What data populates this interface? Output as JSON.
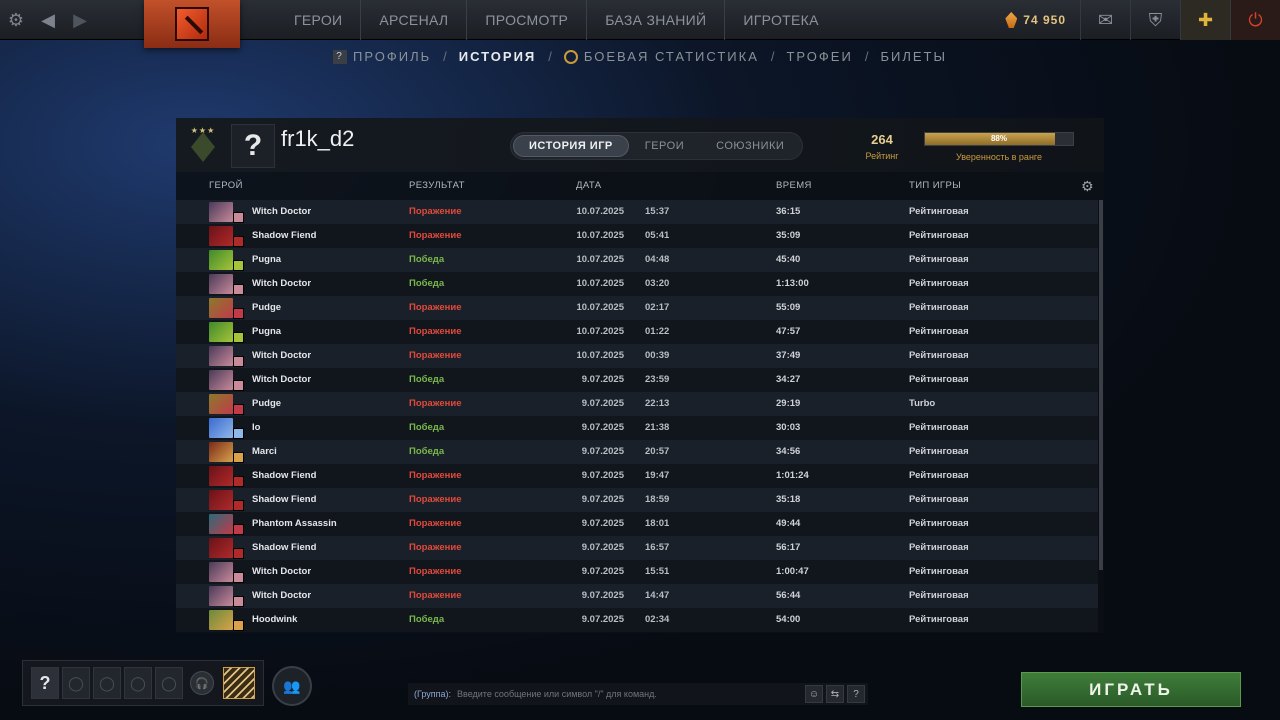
{
  "topbar": {
    "nav": [
      "ГЕРОИ",
      "АРСЕНАЛ",
      "ПРОСМОТР",
      "БАЗА ЗНАНИЙ",
      "ИГРОТЕКА"
    ],
    "currency": "74 950"
  },
  "subnav": {
    "profile": "ПРОФИЛЬ",
    "history": "ИСТОРИЯ",
    "battle_stats": "БОЕВАЯ СТАТИСТИКА",
    "trophies": "ТРОФЕИ",
    "tickets": "БИЛЕТЫ",
    "sep": "/"
  },
  "profile": {
    "avatar_char": "?",
    "name": "fr1k_d2",
    "rank_stars": "★★★"
  },
  "tabs": [
    "ИСТОРИЯ ИГР",
    "ГЕРОИ",
    "СОЮЗНИКИ"
  ],
  "rating": {
    "value": "264",
    "label": "Рейтинг"
  },
  "confidence": {
    "value": 0.88,
    "text": "88%",
    "label": "Уверенность в ранге"
  },
  "columns": {
    "hero": "ГЕРОЙ",
    "result": "РЕЗУЛЬТАТ",
    "date": "ДАТА",
    "duration": "ВРЕМЯ",
    "mode": "ТИП ИГРЫ"
  },
  "matches": [
    {
      "hero": "Witch Doctor",
      "result": "Поражение",
      "win": false,
      "date": "10.07.2025",
      "time": "15:37",
      "duration": "36:15",
      "mode": "Рейтинговая",
      "c1": "#4a3a5a",
      "c2": "#c98a9a"
    },
    {
      "hero": "Shadow Fiend",
      "result": "Поражение",
      "win": false,
      "date": "10.07.2025",
      "time": "05:41",
      "duration": "35:09",
      "mode": "Рейтинговая",
      "c1": "#6a1218",
      "c2": "#b02a2a"
    },
    {
      "hero": "Pugna",
      "result": "Победа",
      "win": true,
      "date": "10.07.2025",
      "time": "04:48",
      "duration": "45:40",
      "mode": "Рейтинговая",
      "c1": "#3f8a2a",
      "c2": "#a6c43a"
    },
    {
      "hero": "Witch Doctor",
      "result": "Победа",
      "win": true,
      "date": "10.07.2025",
      "time": "03:20",
      "duration": "1:13:00",
      "mode": "Рейтинговая",
      "c1": "#4a3a5a",
      "c2": "#c98a9a"
    },
    {
      "hero": "Pudge",
      "result": "Поражение",
      "win": false,
      "date": "10.07.2025",
      "time": "02:17",
      "duration": "55:09",
      "mode": "Рейтинговая",
      "c1": "#8a7a2a",
      "c2": "#c23a4a"
    },
    {
      "hero": "Pugna",
      "result": "Поражение",
      "win": false,
      "date": "10.07.2025",
      "time": "01:22",
      "duration": "47:57",
      "mode": "Рейтинговая",
      "c1": "#3f8a2a",
      "c2": "#a6c43a"
    },
    {
      "hero": "Witch Doctor",
      "result": "Поражение",
      "win": false,
      "date": "10.07.2025",
      "time": "00:39",
      "duration": "37:49",
      "mode": "Рейтинговая",
      "c1": "#4a3a5a",
      "c2": "#c98a9a"
    },
    {
      "hero": "Witch Doctor",
      "result": "Победа",
      "win": true,
      "date": "9.07.2025",
      "time": "23:59",
      "duration": "34:27",
      "mode": "Рейтинговая",
      "c1": "#4a3a5a",
      "c2": "#c98a9a"
    },
    {
      "hero": "Pudge",
      "result": "Поражение",
      "win": false,
      "date": "9.07.2025",
      "time": "22:13",
      "duration": "29:19",
      "mode": "Turbo",
      "c1": "#8a7a2a",
      "c2": "#c23a4a"
    },
    {
      "hero": "Io",
      "result": "Победа",
      "win": true,
      "date": "9.07.2025",
      "time": "21:38",
      "duration": "30:03",
      "mode": "Рейтинговая",
      "c1": "#3a6ad0",
      "c2": "#8fb7e8"
    },
    {
      "hero": "Marci",
      "result": "Победа",
      "win": true,
      "date": "9.07.2025",
      "time": "20:57",
      "duration": "34:56",
      "mode": "Рейтинговая",
      "c1": "#7a2a1a",
      "c2": "#d9a24a"
    },
    {
      "hero": "Shadow Fiend",
      "result": "Поражение",
      "win": false,
      "date": "9.07.2025",
      "time": "19:47",
      "duration": "1:01:24",
      "mode": "Рейтинговая",
      "c1": "#6a1218",
      "c2": "#b02a2a"
    },
    {
      "hero": "Shadow Fiend",
      "result": "Поражение",
      "win": false,
      "date": "9.07.2025",
      "time": "18:59",
      "duration": "35:18",
      "mode": "Рейтинговая",
      "c1": "#6a1218",
      "c2": "#b02a2a"
    },
    {
      "hero": "Phantom Assassin",
      "result": "Поражение",
      "win": false,
      "date": "9.07.2025",
      "time": "18:01",
      "duration": "49:44",
      "mode": "Рейтинговая",
      "c1": "#2a6a7a",
      "c2": "#c23a4a"
    },
    {
      "hero": "Shadow Fiend",
      "result": "Поражение",
      "win": false,
      "date": "9.07.2025",
      "time": "16:57",
      "duration": "56:17",
      "mode": "Рейтинговая",
      "c1": "#6a1218",
      "c2": "#b02a2a"
    },
    {
      "hero": "Witch Doctor",
      "result": "Поражение",
      "win": false,
      "date": "9.07.2025",
      "time": "15:51",
      "duration": "1:00:47",
      "mode": "Рейтинговая",
      "c1": "#4a3a5a",
      "c2": "#c98a9a"
    },
    {
      "hero": "Witch Doctor",
      "result": "Поражение",
      "win": false,
      "date": "9.07.2025",
      "time": "14:47",
      "duration": "56:44",
      "mode": "Рейтинговая",
      "c1": "#4a3a5a",
      "c2": "#c98a9a"
    },
    {
      "hero": "Hoodwink",
      "result": "Победа",
      "win": true,
      "date": "9.07.2025",
      "time": "02:34",
      "duration": "54:00",
      "mode": "Рейтинговая",
      "c1": "#6a8a3a",
      "c2": "#d9a24a"
    }
  ],
  "chat": {
    "channel": "(Группа):",
    "placeholder": "Введите сообщение или символ \"/\" для команд."
  },
  "party": {
    "me": "?"
  },
  "play_button": "ИГРАТЬ",
  "colors": {
    "win": "#78b84a",
    "loss": "#e14a3b",
    "accent_gold": "#c99a3e",
    "play_green": "#3f7d3a"
  }
}
